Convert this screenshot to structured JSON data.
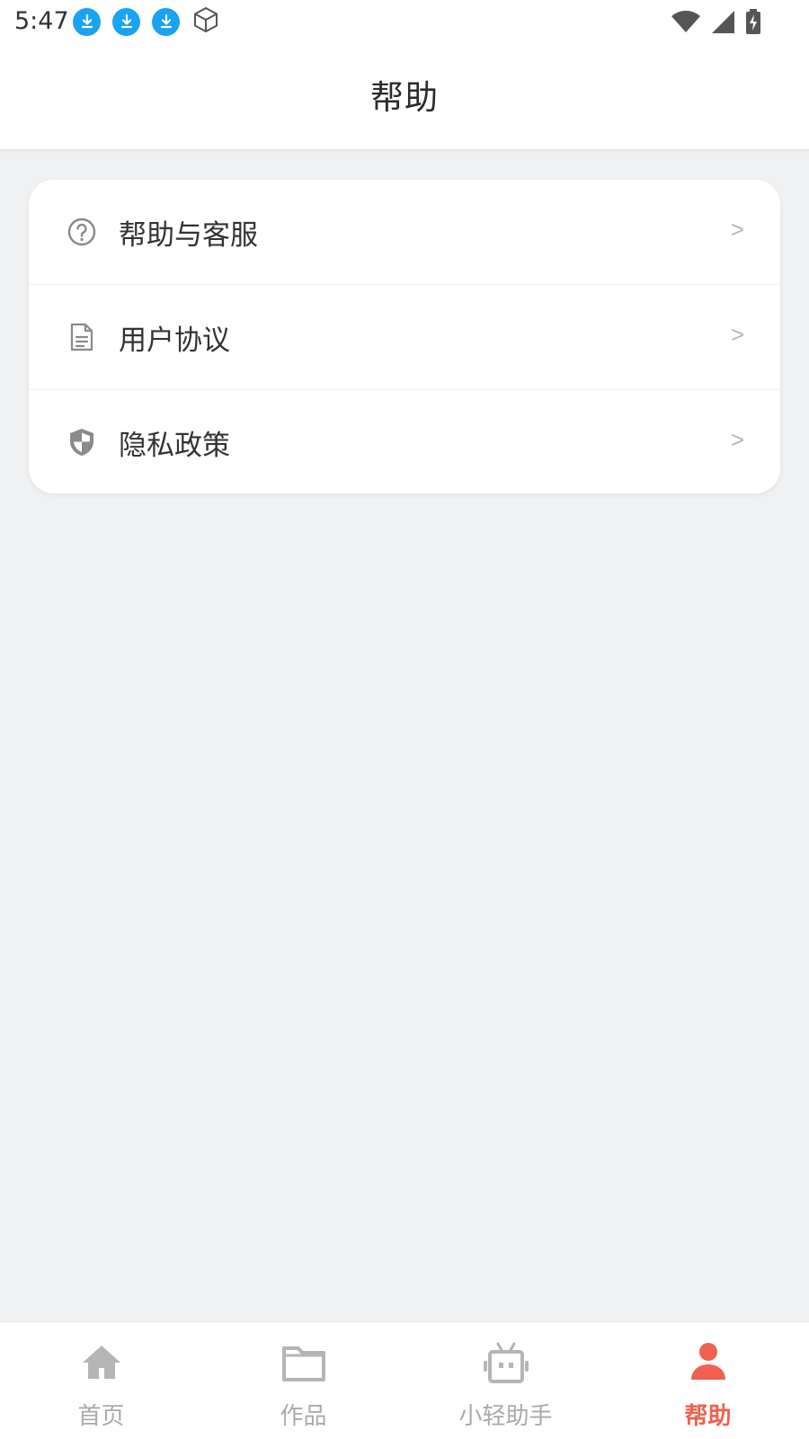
{
  "status_bar": {
    "time": "5:47",
    "left_icons": [
      "download-icon",
      "download-icon",
      "download-icon",
      "box-icon"
    ],
    "right_icons": [
      "wifi-icon",
      "signal-icon",
      "battery-charging-icon"
    ]
  },
  "header": {
    "title": "帮助"
  },
  "menu": {
    "items": [
      {
        "label": "帮助与客服",
        "icon": "help-circle-icon",
        "chevron": ">"
      },
      {
        "label": "用户协议",
        "icon": "document-icon",
        "chevron": ">"
      },
      {
        "label": "隐私政策",
        "icon": "shield-icon",
        "chevron": ">"
      }
    ]
  },
  "bottom_nav": {
    "items": [
      {
        "label": "首页",
        "icon": "home-icon",
        "active": false
      },
      {
        "label": "作品",
        "icon": "folder-icon",
        "active": false
      },
      {
        "label": "小轻助手",
        "icon": "robot-icon",
        "active": false
      },
      {
        "label": "帮助",
        "icon": "person-icon",
        "active": true
      }
    ]
  },
  "colors": {
    "accent": "#f0614f",
    "inactive": "#aaaaaa",
    "background": "#f0f1f3",
    "download_badge": "#1aa3f0"
  }
}
